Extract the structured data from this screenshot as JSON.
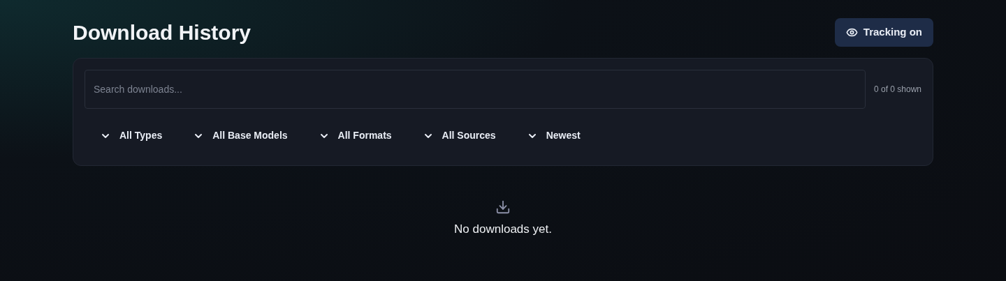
{
  "title": "Download History",
  "tracking_button": {
    "label": "Tracking on"
  },
  "search": {
    "placeholder": "Search downloads..."
  },
  "count": "0 of 0 shown",
  "filters": [
    {
      "label": "All Types"
    },
    {
      "label": "All Base Models"
    },
    {
      "label": "All Formats"
    },
    {
      "label": "All Sources"
    },
    {
      "label": "Newest"
    }
  ],
  "empty_state": {
    "message": "No downloads yet."
  }
}
